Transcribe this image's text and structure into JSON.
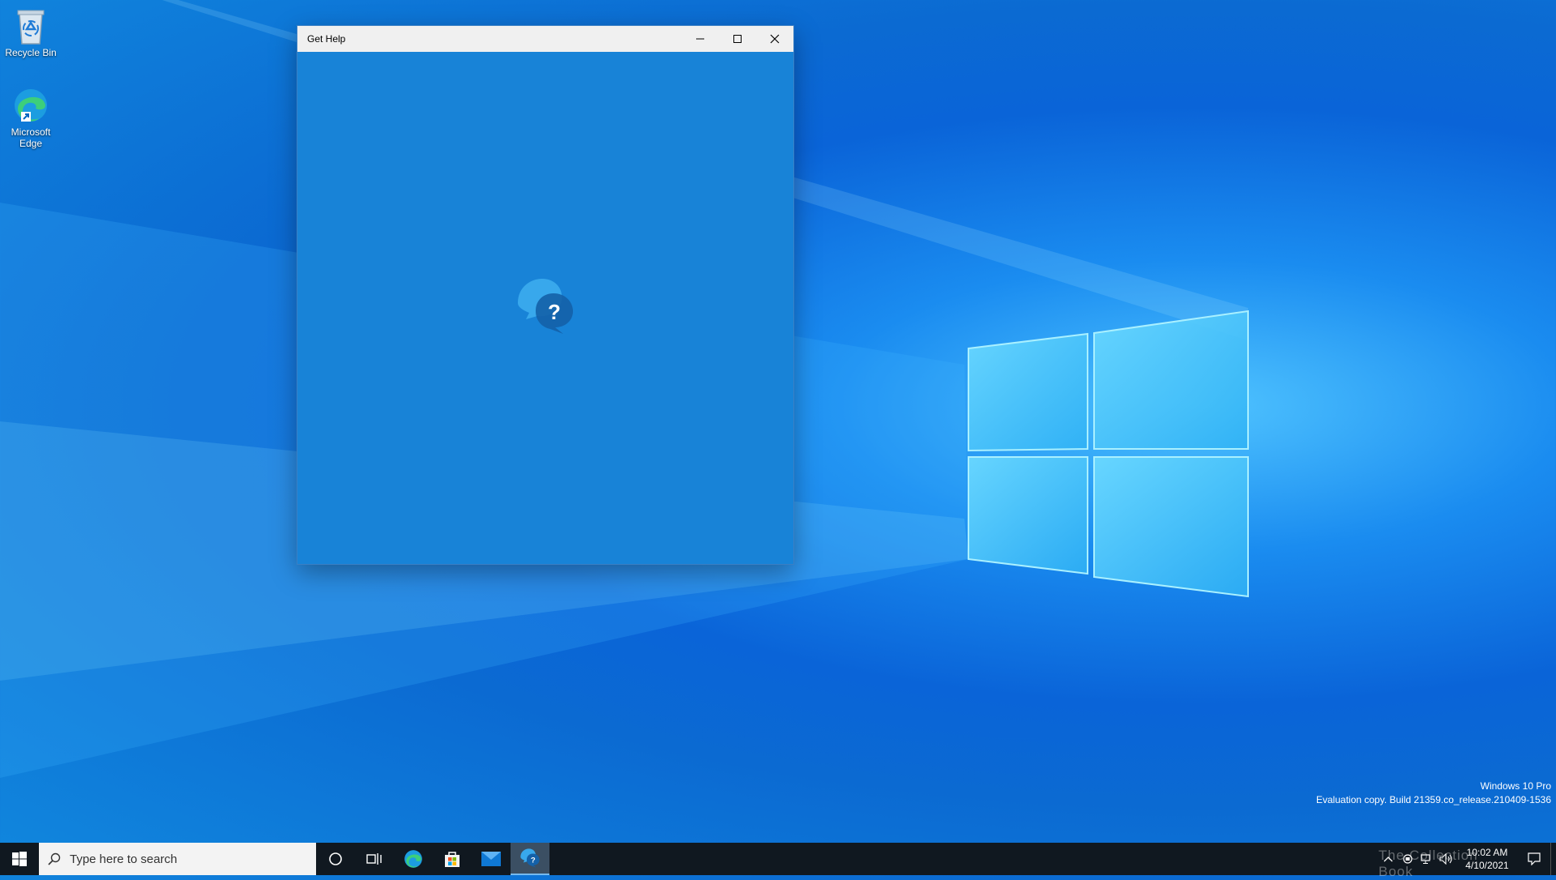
{
  "desktop": {
    "icons": [
      {
        "label": "Recycle Bin",
        "icon": "recycle-bin-icon"
      },
      {
        "label": "Microsoft Edge",
        "icon": "edge-icon"
      }
    ],
    "watermark_line1": "Windows 10 Pro",
    "watermark_line2": "Evaluation copy. Build 21359.co_release.210409-1536"
  },
  "window": {
    "title": "Get Help",
    "background": "#1883d7",
    "splash_icon": "get-help-icon"
  },
  "taskbar": {
    "search_placeholder": "Type here to search",
    "pinned": [
      "cortana-icon",
      "task-view-icon",
      "edge-icon",
      "store-icon",
      "mail-icon",
      "get-help-icon"
    ],
    "active": "get-help-icon",
    "tray_watermark": "The Collection Book",
    "clock_time": "10:02 AM",
    "clock_date": "4/10/2021"
  },
  "colors": {
    "accent": "#1883d7",
    "taskbar": "#101820",
    "desktop": "#0a64d8"
  }
}
